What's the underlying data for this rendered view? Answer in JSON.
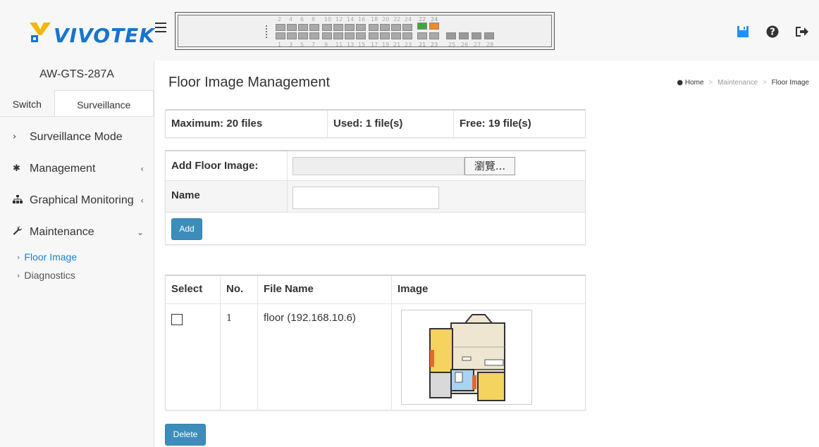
{
  "app": {
    "brand": "VIVOTEK",
    "device_name": "AW-GTS-287A"
  },
  "switch_panel": {
    "top_port_numbers": [
      "2",
      "4",
      "6",
      "8",
      "10",
      "12",
      "14",
      "16",
      "18",
      "20",
      "22",
      "24",
      "22",
      "24"
    ],
    "bottom_port_numbers": [
      "1",
      "3",
      "5",
      "7",
      "9",
      "11",
      "13",
      "15",
      "17",
      "19",
      "21",
      "23",
      "21",
      "23",
      "25",
      "26",
      "27",
      "28"
    ]
  },
  "top_icons": [
    "save-icon",
    "help-icon",
    "logout-icon"
  ],
  "sidebar": {
    "tabs": [
      {
        "label": "Switch",
        "active": false
      },
      {
        "label": "Surveillance",
        "active": true
      }
    ],
    "items": [
      {
        "label": "Surveillance Mode",
        "icon": "chevron-right-icon",
        "caret": ""
      },
      {
        "label": "Management",
        "icon": "gear-icon",
        "caret": "‹"
      },
      {
        "label": "Graphical Monitoring",
        "icon": "sitemap-icon",
        "caret": "‹"
      },
      {
        "label": "Maintenance",
        "icon": "wrench-icon",
        "caret": "⌄"
      }
    ],
    "sub_items": [
      {
        "label": "Floor Image",
        "active": true
      },
      {
        "label": "Diagnostics",
        "active": false
      }
    ]
  },
  "main": {
    "title": "Floor Image Management",
    "breadcrumb": {
      "home": "Home",
      "section": "Maintenance",
      "current": "Floor Image"
    },
    "info": {
      "maximum": "Maximum: 20 files",
      "used": "Used: 1 file(s)",
      "free": "Free: 19 file(s)"
    },
    "add_form": {
      "add_label": "Add Floor Image:",
      "browse_label": "瀏覽...",
      "name_label": "Name",
      "name_value": "",
      "add_button": "Add"
    },
    "table": {
      "headers": [
        "Select",
        "No.",
        "File Name",
        "Image"
      ],
      "rows": [
        {
          "no": "1",
          "file_name": "floor (192.168.10.6)",
          "checked": false
        }
      ]
    },
    "delete_button": "Delete"
  },
  "colors": {
    "accent": "#3c8dbc",
    "brand_blue": "#1874cd",
    "active_link": "#1e7fd4"
  }
}
